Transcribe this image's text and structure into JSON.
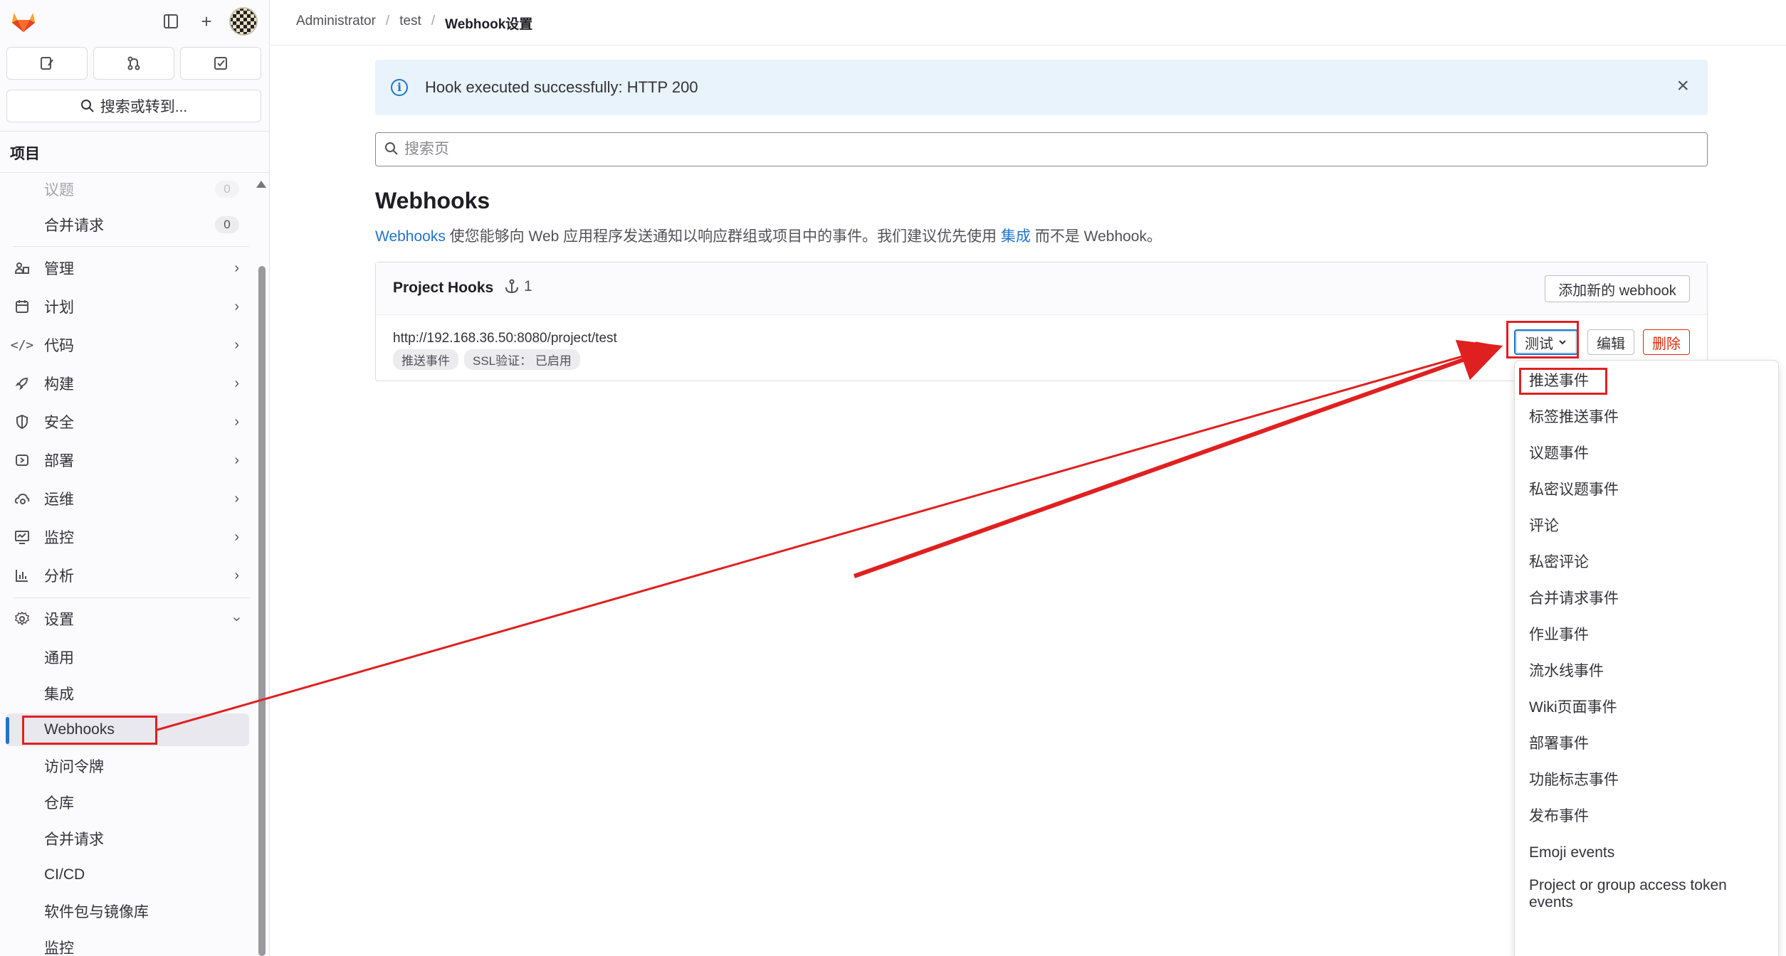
{
  "sidebar": {
    "section_title": "项目",
    "search_label": "搜索或转到...",
    "items": [
      {
        "label": "议题",
        "count": "0"
      },
      {
        "label": "合并请求",
        "count": "0"
      },
      {
        "label": "管理"
      },
      {
        "label": "计划"
      },
      {
        "label": "代码"
      },
      {
        "label": "构建"
      },
      {
        "label": "安全"
      },
      {
        "label": "部署"
      },
      {
        "label": "运维"
      },
      {
        "label": "监控"
      },
      {
        "label": "分析"
      },
      {
        "label": "设置"
      }
    ],
    "settings_items": [
      "通用",
      "集成",
      "Webhooks",
      "访问令牌",
      "仓库",
      "合并请求",
      "CI/CD",
      "软件包与镜像库",
      "监控"
    ]
  },
  "breadcrumb": [
    "Administrator",
    "test",
    "Webhook设置"
  ],
  "alert": {
    "message": "Hook executed successfully: HTTP 200"
  },
  "page_search": {
    "placeholder": "搜索页"
  },
  "heading": {
    "title": "Webhooks",
    "desc_link1": "Webhooks",
    "desc_mid": " 使您能够向 Web 应用程序发送通知以响应群组或项目中的事件。我们建议优先使用 ",
    "desc_link2": "集成",
    "desc_end": " 而不是 Webhook。"
  },
  "card": {
    "title": "Project Hooks",
    "count": "1",
    "add_button": "添加新的 webhook",
    "hook_url": "http://192.168.36.50:8080/project/test",
    "tags": [
      "推送事件",
      "SSL验证：  已启用"
    ],
    "test_button": "测试",
    "edit_button": "编辑",
    "delete_button": "删除"
  },
  "dropdown": {
    "items": [
      "推送事件",
      "标签推送事件",
      "议题事件",
      "私密议题事件",
      "评论",
      "私密评论",
      "合并请求事件",
      "作业事件",
      "流水线事件",
      "Wiki页面事件",
      "部署事件",
      "功能标志事件",
      "发布事件",
      "Emoji events",
      "Project or group access token events"
    ]
  },
  "colors": {
    "accent": "#1f75cb",
    "danger": "#dd2b0e",
    "annotation": "#e02020"
  }
}
